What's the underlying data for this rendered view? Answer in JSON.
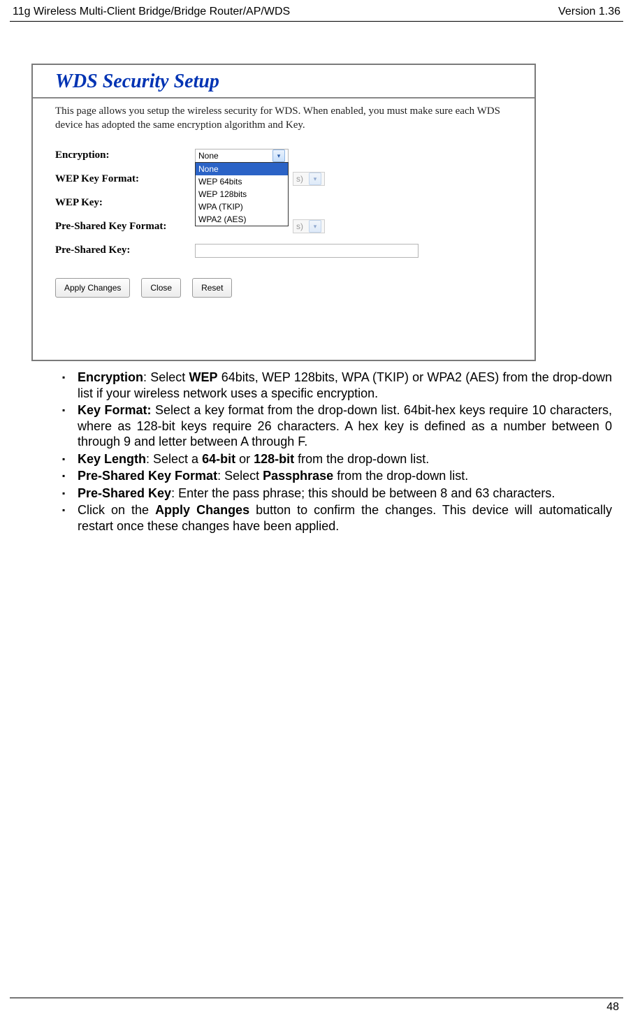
{
  "header": {
    "left": "11g Wireless Multi-Client Bridge/Bridge Router/AP/WDS",
    "right": "Version 1.36"
  },
  "chart_data": null,
  "screenshot": {
    "title": "WDS Security Setup",
    "description": "This page allows you setup the wireless security for WDS. When enabled, you must make sure each WDS device has adopted the same encryption algorithm and Key.",
    "labels": {
      "encryption": "Encryption:",
      "wep_format": "WEP Key Format:",
      "wep_key": "WEP Key:",
      "psk_format": "Pre-Shared Key Format:",
      "psk": "Pre-Shared Key:"
    },
    "encryption_selected": "None",
    "encryption_options": [
      "None",
      "WEP 64bits",
      "WEP 128bits",
      "WPA (TKIP)",
      "WPA2 (AES)"
    ],
    "ghost_suffix": "s)",
    "buttons": {
      "apply": "Apply Changes",
      "close": "Close",
      "reset": "Reset"
    }
  },
  "bullets": {
    "b0_strong": "Encryption",
    "b0_mid1": ": Select ",
    "b0_strong2": "WEP",
    "b0_rest": " 64bits, WEP 128bits, WPA (TKIP) or WPA2 (AES) from the drop-down list if your wireless network uses a specific encryption.",
    "b1_strong": "Key Format:",
    "b1_rest": " Select a key format from the drop-down list. 64bit-hex keys require 10 characters, where as 128-bit keys require 26 characters. A hex key is defined as a number between 0 through 9 and letter between A through F.",
    "b2_strong": "Key Length",
    "b2_mid": ": Select a ",
    "b2_s2": "64-bit",
    "b2_mid2": " or ",
    "b2_s3": "128-bit",
    "b2_end": " from the drop-down list.",
    "b3_strong": "Pre-Shared Key Format",
    "b3_mid": ": Select ",
    "b3_s2": "Passphrase",
    "b3_end": " from the drop-down list.",
    "b4_strong": "Pre-Shared Key",
    "b4_rest": ": Enter the pass phrase; this should be between 8 and 63 characters.",
    "b5_pre": "Click on the ",
    "b5_strong": "Apply Changes",
    "b5_rest": " button to confirm the changes. This device will automatically restart once these changes have been applied."
  },
  "footer": {
    "page": "48"
  }
}
